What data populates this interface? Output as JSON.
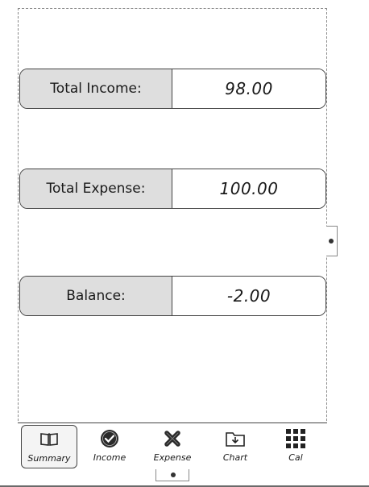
{
  "summary": {
    "income_label": "Total Income:",
    "income_value": "98.00",
    "expense_label": "Total Expense:",
    "expense_value": "100.00",
    "balance_label": "Balance:",
    "balance_value": "-2.00"
  },
  "tabs": [
    {
      "label": "Summary",
      "icon": "book-icon",
      "active": true
    },
    {
      "label": "Income",
      "icon": "check-circle-icon",
      "active": false
    },
    {
      "label": "Expense",
      "icon": "x-mark-icon",
      "active": false
    },
    {
      "label": "Chart",
      "icon": "folder-download-icon",
      "active": false
    },
    {
      "label": "Cal",
      "icon": "grid-icon",
      "active": false
    }
  ]
}
